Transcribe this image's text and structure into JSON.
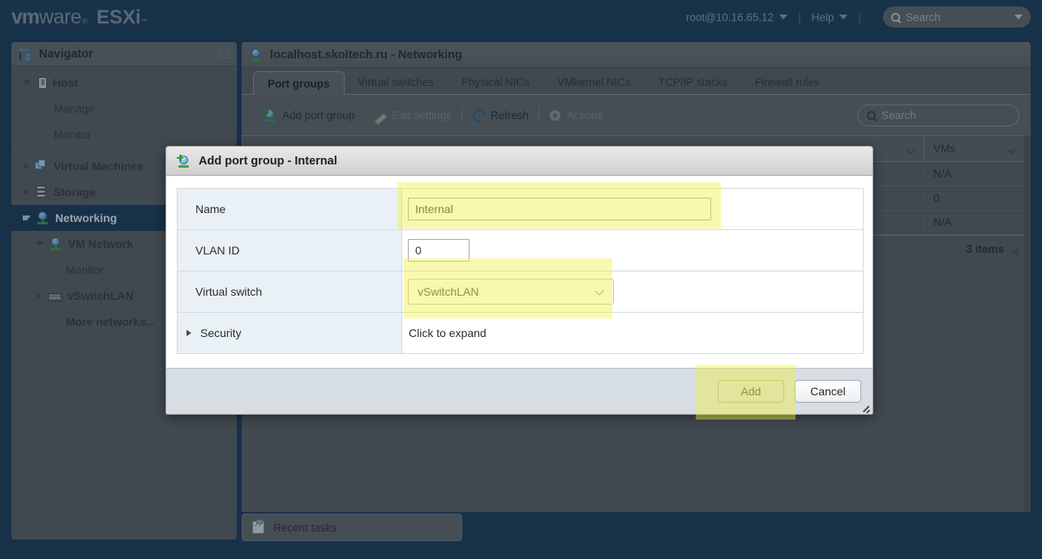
{
  "app": {
    "brand_vm": "vm",
    "brand_ware": "ware",
    "brand_reg": "®",
    "brand_product": "ESXi",
    "brand_tm": "™"
  },
  "header": {
    "user": "root@10.16.65.12",
    "help": "Help",
    "separator": "|",
    "search_placeholder": "Search"
  },
  "navigator": {
    "title": "Navigator",
    "items": [
      {
        "label": "Host",
        "indent": 0,
        "arrow": "open",
        "icon": "host-icon",
        "bold": true
      },
      {
        "label": "Manage",
        "indent": 1,
        "arrow": "none",
        "icon": "none",
        "bold": false
      },
      {
        "label": "Monitor",
        "indent": 1,
        "arrow": "none",
        "icon": "none",
        "bold": false
      },
      {
        "label": "Virtual Machines",
        "indent": 0,
        "arrow": "closed",
        "icon": "vm-icon",
        "bold": true
      },
      {
        "label": "Storage",
        "indent": 0,
        "arrow": "closed",
        "icon": "storage-icon",
        "bold": true
      },
      {
        "label": "Networking",
        "indent": 0,
        "arrow": "open",
        "icon": "network-icon",
        "bold": true,
        "selected": true
      },
      {
        "label": "VM Network",
        "indent": 1,
        "arrow": "open",
        "icon": "network-icon",
        "bold": true
      },
      {
        "label": "Monitor",
        "indent": 2,
        "arrow": "none",
        "icon": "none",
        "bold": false
      },
      {
        "label": "vSwitchLAN",
        "indent": 1,
        "arrow": "closed",
        "icon": "switch-icon",
        "bold": true
      },
      {
        "label": "More networks...",
        "indent": 2,
        "arrow": "none",
        "icon": "none",
        "bold": true
      }
    ]
  },
  "content": {
    "title": "localhost.skoltech.ru - Networking",
    "tabs": [
      {
        "label": "Port groups",
        "active": true
      },
      {
        "label": "Virtual switches",
        "active": false
      },
      {
        "label": "Physical NICs",
        "active": false
      },
      {
        "label": "VMkernel NICs",
        "active": false
      },
      {
        "label": "TCP/IP stacks",
        "active": false
      },
      {
        "label": "Firewall rules",
        "active": false
      }
    ],
    "toolbar": {
      "add_port_group": "Add port group",
      "edit_settings": "Edit settings",
      "refresh": "Refresh",
      "actions": "Actions",
      "search_placeholder": "Search"
    },
    "table": {
      "columns": [
        "VMs"
      ],
      "rows": [
        {
          "vms": "N/A"
        },
        {
          "vms": "0"
        },
        {
          "vms": "N/A"
        }
      ],
      "footer": "3 items"
    }
  },
  "recent_tasks": {
    "label": "Recent tasks"
  },
  "dialog": {
    "title": "Add port group - Internal",
    "fields": {
      "name_label": "Name",
      "name_value": "Internal",
      "vlan_label": "VLAN ID",
      "vlan_value": "0",
      "vswitch_label": "Virtual switch",
      "vswitch_value": "vSwitchLAN",
      "security_label": "Security",
      "security_value": "Click to expand"
    },
    "buttons": {
      "add": "Add",
      "cancel": "Cancel"
    }
  },
  "colors": {
    "brand_bar": "#1d3c56",
    "selection": "#1b3a56",
    "highlight": "#f0f03c",
    "label_cell": "#e9f1f7",
    "dialog_footer": "#d6dde3"
  }
}
